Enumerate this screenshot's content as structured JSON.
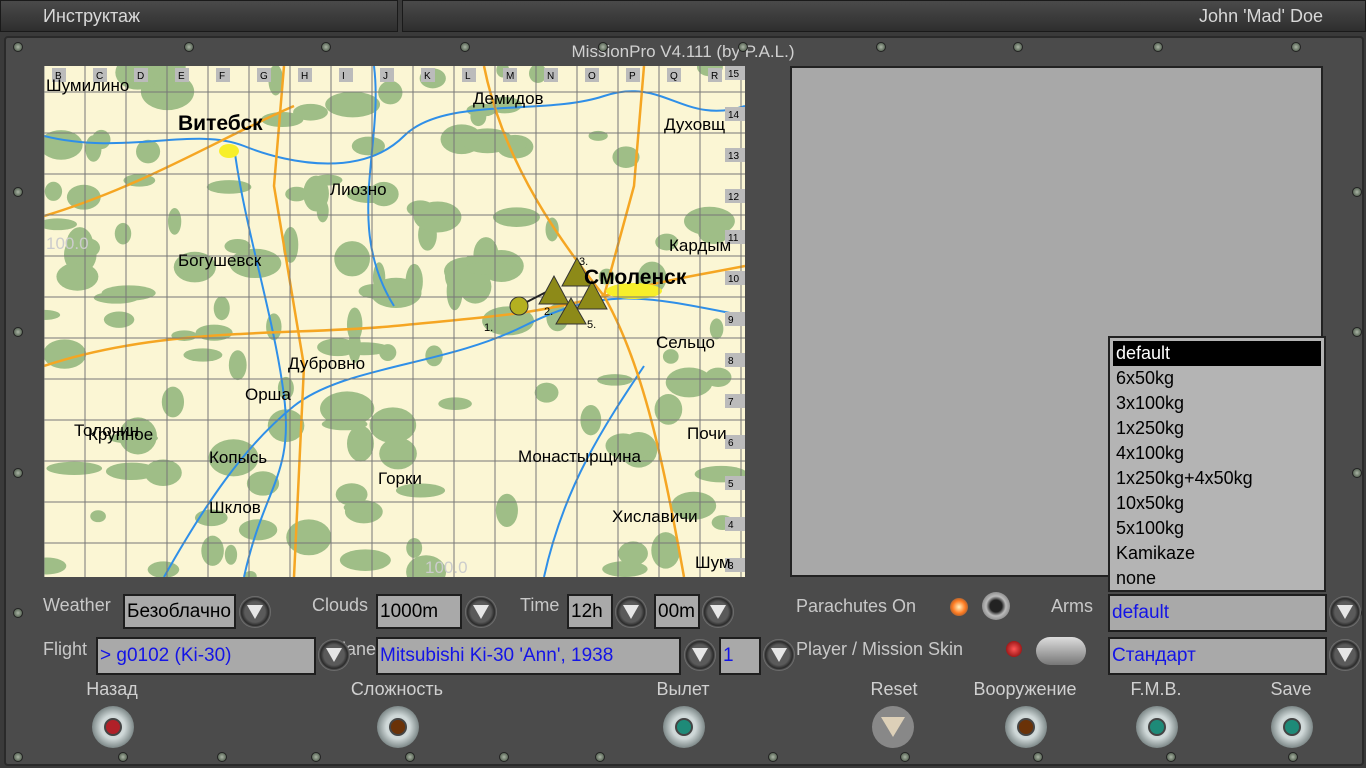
{
  "topbar": {
    "left": "Инструктаж",
    "right": "John 'Mad' Doe"
  },
  "title": "MissionPro V4.111 (by P.A.L.)",
  "map": {
    "columns": [
      "B",
      "C",
      "D",
      "E",
      "F",
      "G",
      "H",
      "I",
      "J",
      "K",
      "L",
      "M",
      "N",
      "O",
      "P",
      "Q",
      "R"
    ],
    "rows": [
      "15",
      "14",
      "13",
      "12",
      "11",
      "10",
      "9",
      "8",
      "7",
      "6",
      "5",
      "4",
      "3"
    ],
    "cities": [
      "Шумилино",
      "Витебск",
      "Демидов",
      "Духовщ",
      "Лиозно",
      "Богушевск",
      "Кардым",
      "Смоленск",
      "Сельцо",
      "Дубровно",
      "Орша",
      "Толочин",
      "Крупное",
      "Почи",
      "Копысь",
      "Монастырщина",
      "Горки",
      "Шклов",
      "Хиславичи",
      "Шум"
    ],
    "watermarks": [
      "100.0",
      "100.0"
    ],
    "waypoints": [
      "1.",
      "2.",
      "3.",
      "5."
    ]
  },
  "weather": {
    "label": "Weather",
    "value": "Безоблачно"
  },
  "clouds": {
    "label": "Clouds",
    "value": "1000m"
  },
  "time": {
    "label": "Time",
    "hours": "12h",
    "minutes": "00m"
  },
  "flight": {
    "label": "Flight",
    "value": "> g0102 (Ki-30)"
  },
  "plane": {
    "label": "Plane",
    "value": "Mitsubishi Ki-30 'Ann', 1938",
    "count": "1"
  },
  "parachutes": {
    "label": "Parachutes On"
  },
  "arms": {
    "label": "Arms",
    "value": "default",
    "options": [
      "default",
      "6x50kg",
      "3x100kg",
      "1x250kg",
      "4x100kg",
      "1x250kg+4x50kg",
      "10x50kg",
      "5x100kg",
      "Kamikaze",
      "none"
    ]
  },
  "skin": {
    "label": "Player / Mission Skin",
    "value": "Стандарт"
  },
  "buttons": {
    "back": "Назад",
    "difficulty": "Сложность",
    "fly": "Вылет",
    "reset": "Reset",
    "loadout": "Вооружение",
    "fmb": "F.M.B.",
    "save": "Save"
  },
  "colors": {
    "map_bg": "#fbf6d4",
    "forest": "#8fb57a",
    "river": "#2f8fe8",
    "road": "#f5a623",
    "field": "#a9a9a9",
    "value_text": "#1414e6"
  }
}
